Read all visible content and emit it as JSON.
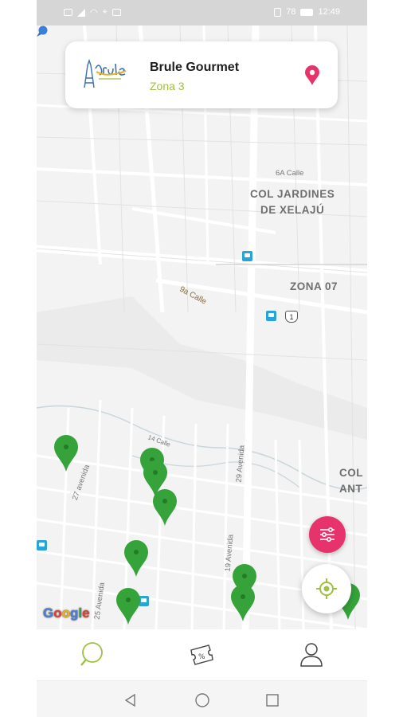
{
  "status_bar": {
    "left_icons": [
      "sim-icon",
      "signal-icon",
      "wifi-icon",
      "location-status-icon",
      "image-icon"
    ],
    "battery_percent": "78",
    "time": "12:49"
  },
  "header": {
    "logo_text": "Brulé Gourmet",
    "store_name": "Brule Gourmet",
    "zone": "Zona 3",
    "location_icon": "map-pin-icon"
  },
  "map": {
    "area_labels": [
      {
        "text": "COL JARDINES\nDE XELAJÚ"
      },
      {
        "text": "ZONA 07"
      },
      {
        "text": "COL\nANT"
      }
    ],
    "street_labels": [
      "6A Calle",
      "9a Calle",
      "14 Calle",
      "27 avenida",
      "29 Avenida",
      "19 Avenida",
      "25 Avenida"
    ],
    "route_shield": "1",
    "attribution": "Google",
    "marker_color": "#35a33a",
    "marker_count": 10
  },
  "fabs": {
    "filter_icon": "filter-sliders-icon",
    "filter_color": "#e7336b",
    "locate_icon": "gps-target-icon",
    "locate_color": "#9ec043"
  },
  "bottom_nav": {
    "items": [
      {
        "icon": "map-search-icon",
        "active": true
      },
      {
        "icon": "discount-ticket-icon",
        "active": false
      },
      {
        "icon": "profile-icon",
        "active": false
      }
    ],
    "active_color": "#9ec043"
  },
  "android_nav": [
    "back-icon",
    "home-icon",
    "recents-icon"
  ]
}
